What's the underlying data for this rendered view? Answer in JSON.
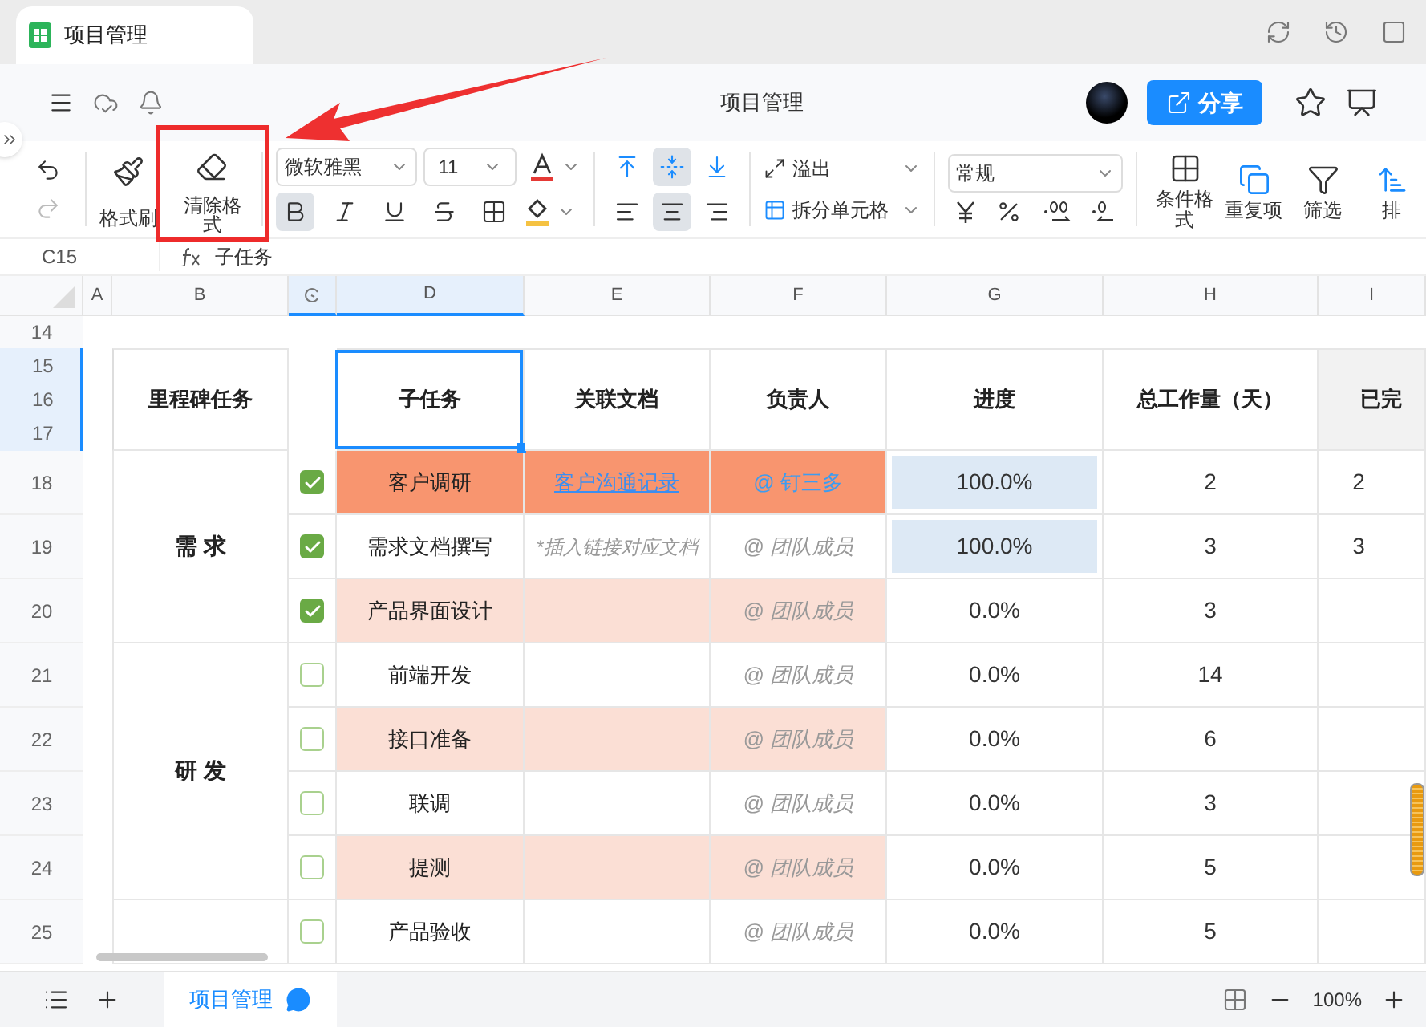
{
  "tab": {
    "title": "项目管理"
  },
  "header": {
    "title": "项目管理",
    "share": "分享"
  },
  "toolbar": {
    "format_painter": "格式刷",
    "clear_format": {
      "label": "清除格式",
      "annotated": true
    },
    "font": "微软雅黑",
    "size": "11",
    "bold": true,
    "italic": false,
    "underline": false,
    "strike": false,
    "vertical_align": [
      {
        "selected": false
      },
      {
        "selected": true
      },
      {
        "selected": false
      }
    ],
    "horizontal_align": [
      {
        "selected": false
      },
      {
        "selected": true
      },
      {
        "selected": false
      }
    ],
    "overflow": "溢出",
    "split": "拆分单元格",
    "number_format": "常规",
    "cond_format": "条件格式",
    "duplicates": "重复项",
    "filter": "筛选",
    "sort": "排"
  },
  "formula_bar": {
    "cell": "C15",
    "content": "子任务"
  },
  "columns": [
    {
      "label": "A",
      "selected": false
    },
    {
      "label": "B",
      "selected": false
    },
    {
      "kind": "icon",
      "selected": true
    },
    {
      "label": "D",
      "selected": true
    },
    {
      "label": "E",
      "selected": false
    },
    {
      "label": "F",
      "selected": false
    },
    {
      "label": "G",
      "selected": false
    },
    {
      "label": "H",
      "selected": false
    },
    {
      "label": "I",
      "selected": false
    }
  ],
  "title_row": {
    "number": "14"
  },
  "header_rows": [
    {
      "number": "15",
      "selected": true
    },
    {
      "number": "16",
      "selected": true
    },
    {
      "number": "17",
      "selected": true
    }
  ],
  "header_cells": [
    "里程碑任务",
    "子任务",
    "关联文档",
    "负责人",
    "进度",
    "总工作量（天）",
    "已完"
  ],
  "groups": [
    {
      "name": "需 求",
      "rows": [
        {
          "number": "18",
          "done": true,
          "task": "客户调研",
          "color": "#f8956f",
          "doc": {
            "kind": "link",
            "text": "客户沟通记录"
          },
          "owner": {
            "kind": "mention",
            "text": "@ 钉三多"
          },
          "progress": "100.0%",
          "highlighted": true,
          "total": "2",
          "completed": "2"
        },
        {
          "number": "19",
          "done": true,
          "task": "需求文档撰写",
          "color": "#ffffff",
          "doc": {
            "kind": "placeholder",
            "text": "*插入链接对应文档"
          },
          "owner": {
            "kind": "placeholder",
            "text": "@ 团队成员"
          },
          "progress": "100.0%",
          "highlighted": true,
          "total": "3",
          "completed": "3"
        },
        {
          "number": "20",
          "done": true,
          "task": "产品界面设计",
          "color": "#fbdfd5",
          "owner": {
            "kind": "placeholder",
            "text": "@ 团队成员"
          },
          "progress": "0.0%",
          "highlighted": false,
          "total": "3"
        }
      ]
    },
    {
      "name": "研 发",
      "rows": [
        {
          "number": "21",
          "done": false,
          "task": "前端开发",
          "color": "#ffffff",
          "owner": {
            "kind": "placeholder",
            "text": "@ 团队成员"
          },
          "progress": "0.0%",
          "highlighted": false,
          "total": "14"
        },
        {
          "number": "22",
          "done": false,
          "task": "接口准备",
          "color": "#fbdfd5",
          "owner": {
            "kind": "placeholder",
            "text": "@ 团队成员"
          },
          "progress": "0.0%",
          "highlighted": false,
          "total": "6"
        },
        {
          "number": "23",
          "done": false,
          "task": "联调",
          "color": "#ffffff",
          "owner": {
            "kind": "placeholder",
            "text": "@ 团队成员"
          },
          "progress": "0.0%",
          "highlighted": false,
          "total": "3"
        },
        {
          "number": "24",
          "done": false,
          "task": "提测",
          "color": "#fbdfd5",
          "owner": {
            "kind": "placeholder",
            "text": "@ 团队成员"
          },
          "progress": "0.0%",
          "highlighted": false,
          "total": "5"
        }
      ]
    },
    {
      "rows": [
        {
          "number": "25",
          "done": false,
          "task": "产品验收",
          "color": "#ffffff",
          "owner": {
            "kind": "placeholder",
            "text": "@ 团队成员"
          },
          "progress": "0.0%",
          "highlighted": false,
          "total": "5"
        }
      ]
    }
  ],
  "sheet_tabs": [
    {
      "label": "项目管理",
      "selected": true
    }
  ],
  "zoom": "100%"
}
